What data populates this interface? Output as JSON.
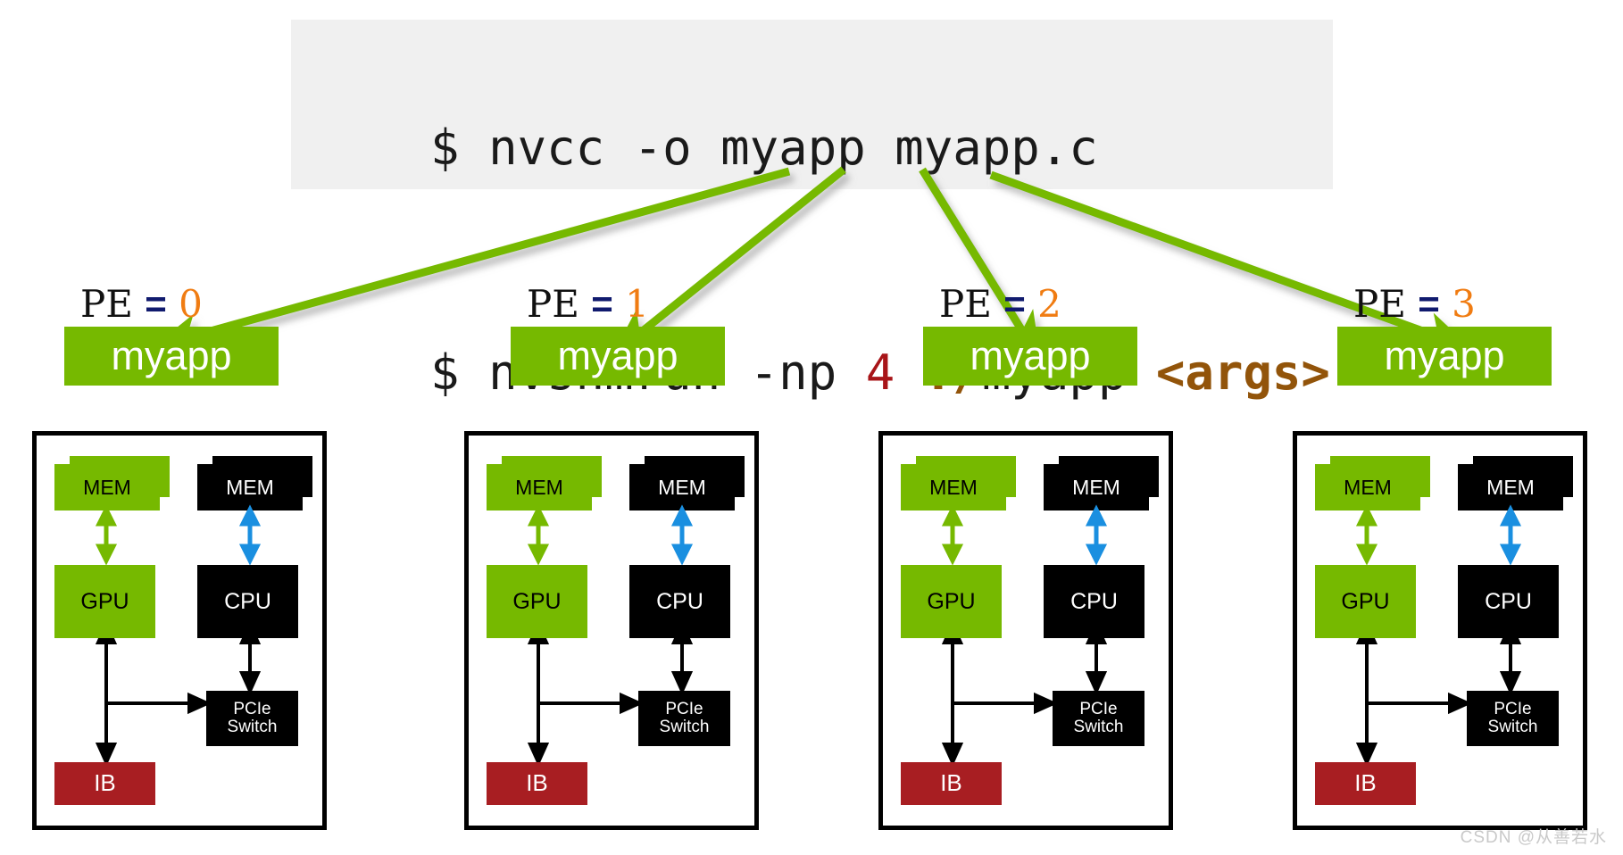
{
  "code_box": {
    "background": "#f0f0f0",
    "lines": [
      {
        "prompt": "$ ",
        "segments": [
          {
            "text": "nvcc -o myapp myapp.c",
            "color": "#1a1a1a"
          }
        ]
      },
      {
        "prompt": "$ ",
        "segments": [
          {
            "text": "nvshmrun -np ",
            "color": "#1a1a1a"
          },
          {
            "text": "4",
            "color": "#a81418"
          },
          {
            "text": " ",
            "color": "#1a1a1a"
          },
          {
            "text": "./",
            "color": "#92540a"
          },
          {
            "text": "myapp ",
            "color": "#1a1a1a"
          },
          {
            "text": "<args>",
            "color": "#92540a"
          }
        ]
      }
    ],
    "line1_plain": "$ nvcc -o myapp myapp.c",
    "line2_plain": "$ nvshmrun -np 4 ./myapp <args>"
  },
  "colors": {
    "nvidia_green": "#76b900",
    "black": "#000000",
    "ib_red": "#a81e22",
    "arrow_green": "#76b900",
    "pe_equals_blue": "#101a6e",
    "pe_number_orange": "#f07c12",
    "cpu_arrow_blue": "#1a8fe0",
    "code_red": "#a81418",
    "code_brown": "#92540a",
    "code_bg": "#f0f0f0"
  },
  "pes": [
    {
      "pe_word": "PE",
      "equals": "=",
      "rank": "0",
      "app_label": "myapp",
      "node": {
        "gpu_mem_label": "MEM",
        "gpu_label": "GPU",
        "cpu_mem_label": "MEM",
        "cpu_label": "CPU",
        "pcie_line1": "PCIe",
        "pcie_line2": "Switch",
        "ib_label": "IB"
      }
    },
    {
      "pe_word": "PE",
      "equals": "=",
      "rank": "1",
      "app_label": "myapp",
      "node": {
        "gpu_mem_label": "MEM",
        "gpu_label": "GPU",
        "cpu_mem_label": "MEM",
        "cpu_label": "CPU",
        "pcie_line1": "PCIe",
        "pcie_line2": "Switch",
        "ib_label": "IB"
      }
    },
    {
      "pe_word": "PE",
      "equals": "=",
      "rank": "2",
      "app_label": "myapp",
      "node": {
        "gpu_mem_label": "MEM",
        "gpu_label": "GPU",
        "cpu_mem_label": "MEM",
        "cpu_label": "CPU",
        "pcie_line1": "PCIe",
        "pcie_line2": "Switch",
        "ib_label": "IB"
      }
    },
    {
      "pe_word": "PE",
      "equals": "=",
      "rank": "3",
      "app_label": "myapp",
      "node": {
        "gpu_mem_label": "MEM",
        "gpu_label": "GPU",
        "cpu_mem_label": "MEM",
        "cpu_label": "CPU",
        "pcie_line1": "PCIe",
        "pcie_line2": "Switch",
        "ib_label": "IB"
      }
    }
  ],
  "watermark": "CSDN @从善若水"
}
